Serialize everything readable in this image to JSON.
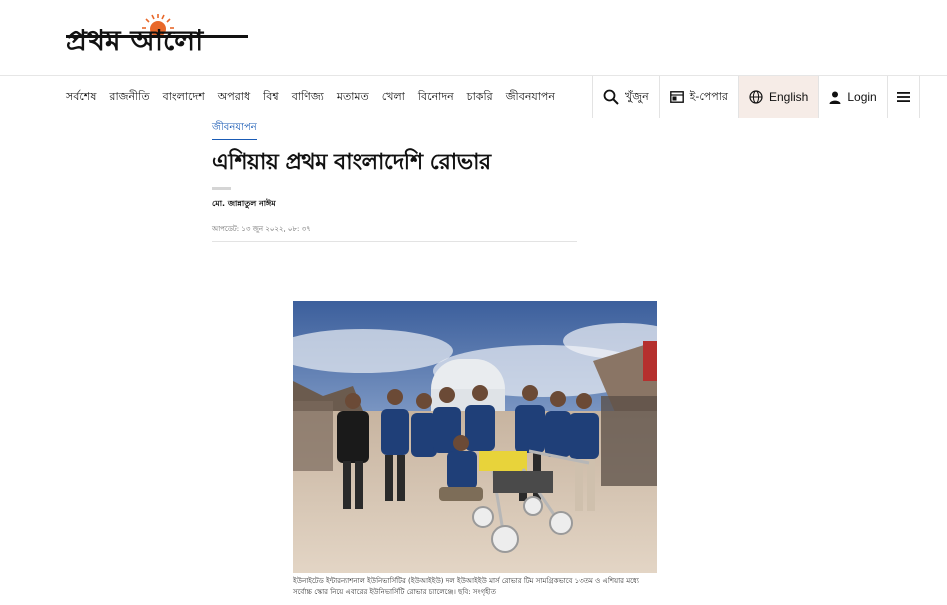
{
  "brand": {
    "logo_text": "প্রথম আলো",
    "sun_color": "#e8682a"
  },
  "nav": {
    "links": [
      "সর্বশেষ",
      "রাজনীতি",
      "বাংলাদেশ",
      "অপরাধ",
      "বিশ্ব",
      "বাণিজ্য",
      "মতামত",
      "খেলা",
      "বিনোদন",
      "চাকরি",
      "জীবনযাপন"
    ],
    "search": {
      "icon": "search-icon",
      "label": "খুঁজুন"
    },
    "epaper": {
      "icon": "newspaper-icon",
      "label": "ই-পেপার"
    },
    "english": {
      "icon": "globe-icon",
      "label": "English"
    },
    "login": {
      "icon": "user-icon",
      "label": "Login"
    },
    "menu": {
      "icon": "hamburger-menu-icon"
    }
  },
  "article": {
    "category": "জীবনযাপন",
    "headline": "এশিয়ায় প্রথম বাংলাদেশি রোভার",
    "author": "মো. জান্নাতুল নাঈম",
    "updated": "আপডেট: ১৩ জুন ২০২২, ০৮: ৩৭",
    "photo_caption": "ইউনাইটেড ইন্টারন্যাশনাল ইউনিভার্সিটির (ইউআইইউ) দল ইউআইইউ মার্স রোভার টিম সামগ্রিকভাবে ১৩তম ও এশিয়ার মধ্যে সর্বোচ্চ স্কোর নিয়ে এবারের ইউনিভার্সিটি রোভার চ্যালেঞ্জে। ছবি: সংগৃহীত"
  },
  "accent_colors": {
    "link_blue": "#1a5bb5",
    "english_bg": "#f6ece7"
  }
}
